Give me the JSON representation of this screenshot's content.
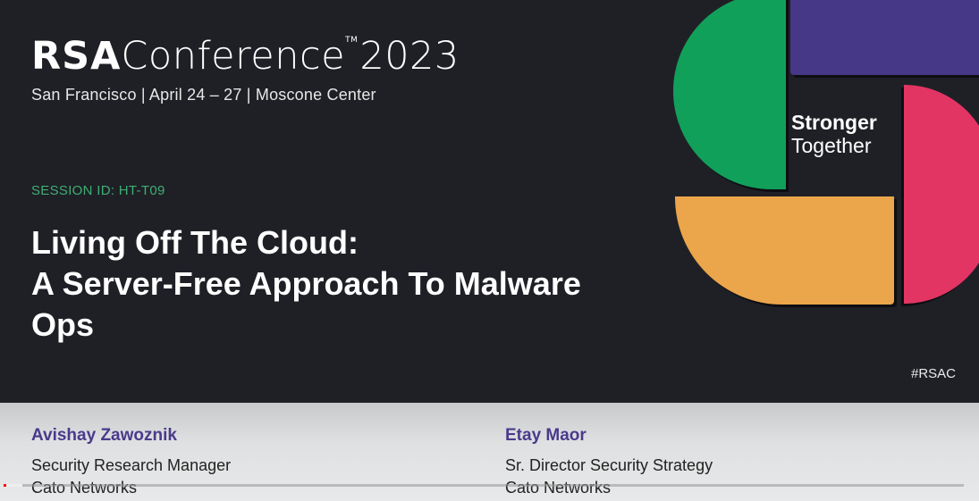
{
  "event": {
    "brand": "RSA",
    "name": "Conference",
    "trademark": "TM",
    "year": "2023",
    "details": "San Francisco  |  April 24 – 27  |  Moscone Center"
  },
  "session": {
    "id_label": "SESSION ID:  HT-T09",
    "title_lines": [
      "Living Off The Cloud:",
      "A Server-Free Approach To Malware",
      "Ops"
    ]
  },
  "tagline": {
    "line1": "Stronger",
    "line2": "Together"
  },
  "hashtag": "#RSAC",
  "speakers": [
    {
      "name": "Avishay Zawoznik",
      "role": "Security Research Manager",
      "company": "Cato Networks"
    },
    {
      "name": "Etay Maor",
      "role": "Sr. Director Security Strategy",
      "company": "Cato Networks"
    }
  ],
  "video": {
    "progress_played_fraction": 0.003,
    "progress_buffered_fraction": 0.02
  },
  "colors": {
    "background": "#1f2026",
    "session_green": "#3fae74",
    "shape_green": "#11a05a",
    "shape_purple": "#463787",
    "shape_pink": "#e23563",
    "shape_orange": "#eba54a",
    "speaker_name_purple": "#4a3a8c",
    "progress_red": "#ff0000"
  }
}
